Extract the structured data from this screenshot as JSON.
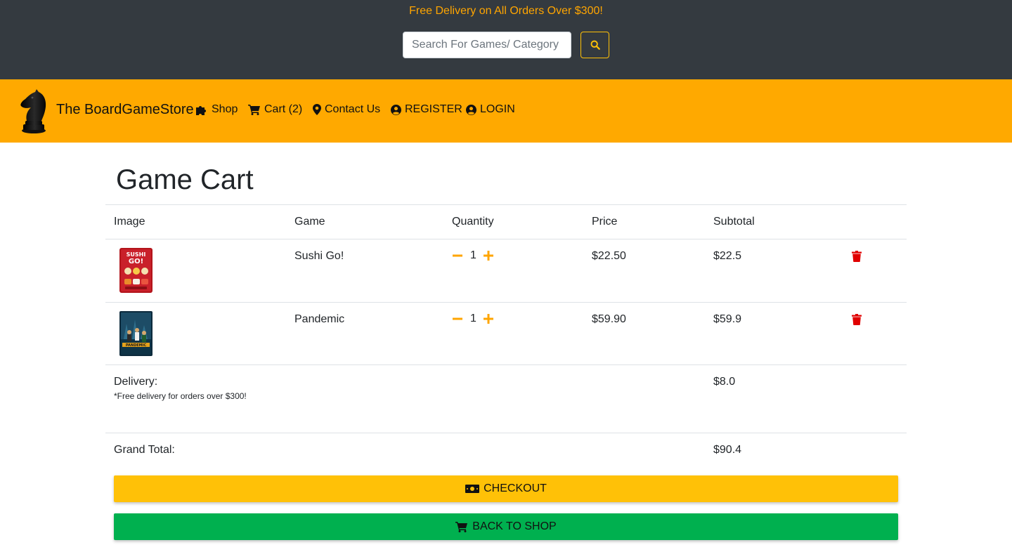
{
  "promo": {
    "text": "Free Delivery on All Orders Over $300!"
  },
  "search": {
    "placeholder": "Search For Games/ Category",
    "button_icon": "search-icon"
  },
  "colors": {
    "topbar": "#343a40",
    "promo": "#ffa500",
    "navbar": "#ffa900",
    "checkout": "#ffc107",
    "back": "#00b04f",
    "qty_icon": "#ffa500",
    "trash": "#e00000"
  },
  "navbar": {
    "brand": "The BoardGameStore",
    "logo_icon": "chess-knight-icon",
    "items": [
      {
        "label": "Shop",
        "icon": "puzzle-icon"
      },
      {
        "label": "Cart (2)",
        "icon": "cart-icon"
      },
      {
        "label": "Contact Us",
        "icon": "map-pin-icon"
      },
      {
        "label": "REGISTER",
        "icon": "user-circle-icon"
      },
      {
        "label": "LOGIN",
        "icon": "user-circle-icon"
      }
    ]
  },
  "cart": {
    "title": "Game Cart",
    "headers": [
      "Image",
      "Game",
      "Quantity",
      "Price",
      "Subtotal"
    ],
    "items": [
      {
        "game": "Sushi Go!",
        "quantity": "1",
        "price": "$22.50",
        "subtotal": "$22.5"
      },
      {
        "game": "Pandemic",
        "quantity": "1",
        "price": "$59.90",
        "subtotal": "$59.9"
      }
    ],
    "delivery_label": "Delivery:",
    "delivery_note": "*Free delivery for orders over $300!",
    "delivery_value": "$8.0",
    "grand_total_label": "Grand Total:",
    "grand_total_value": "$90.4"
  },
  "buttons": {
    "checkout": "CHECKOUT",
    "back": "BACK TO SHOP"
  }
}
